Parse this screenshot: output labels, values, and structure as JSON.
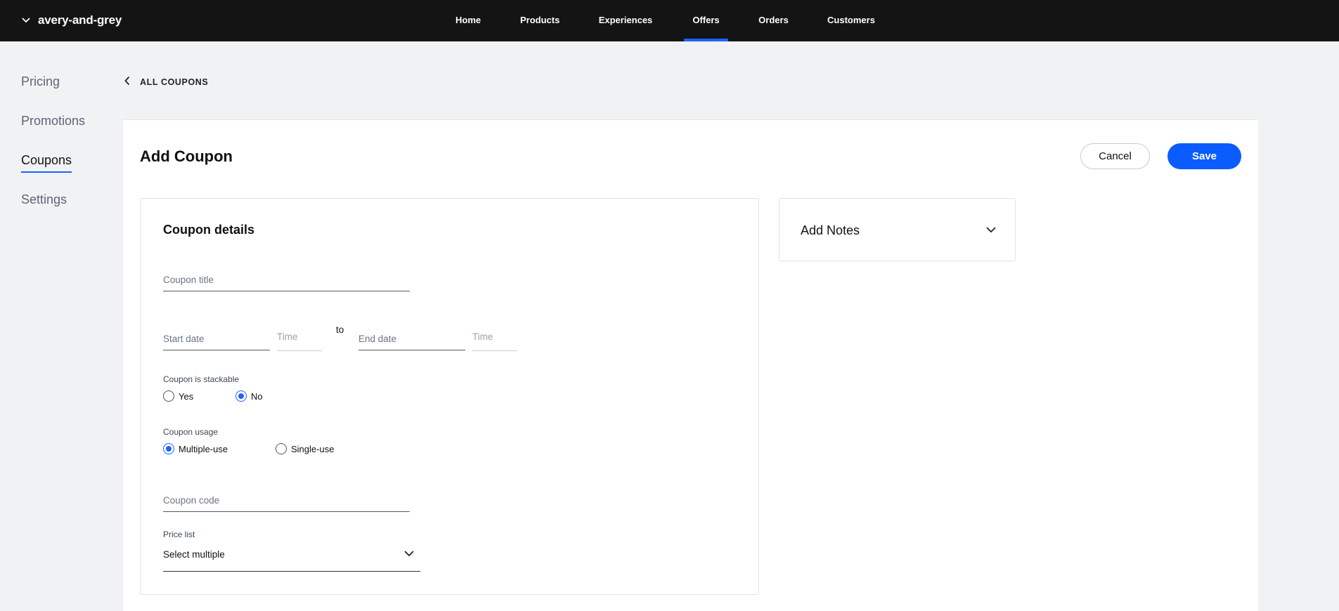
{
  "topbar": {
    "store_name": "avery-and-grey",
    "nav": [
      "Home",
      "Products",
      "Experiences",
      "Offers",
      "Orders",
      "Customers"
    ],
    "active_nav": "Offers"
  },
  "sidebar": {
    "items": [
      "Pricing",
      "Promotions",
      "Coupons",
      "Settings"
    ],
    "active": "Coupons"
  },
  "breadcrumb": {
    "back_label": "ALL COUPONS"
  },
  "page": {
    "title": "Add Coupon",
    "cancel_label": "Cancel",
    "save_label": "Save"
  },
  "details": {
    "title": "Coupon details",
    "coupon_title_placeholder": "Coupon title",
    "start_date_placeholder": "Start date",
    "start_time_placeholder": "Time",
    "to_label": "to",
    "end_date_placeholder": "End date",
    "end_time_placeholder": "Time",
    "stackable_label": "Coupon is stackable",
    "stackable_yes": "Yes",
    "stackable_no": "No",
    "stackable_selected": "No",
    "usage_label": "Coupon usage",
    "usage_multiple": "Multiple-use",
    "usage_single": "Single-use",
    "usage_selected": "Multiple-use",
    "coupon_code_placeholder": "Coupon code",
    "price_list_label": "Price list",
    "price_list_value": "Select multiple"
  },
  "notes": {
    "title": "Add Notes"
  },
  "colors": {
    "accent": "#0b5cff",
    "topbar": "#141414",
    "background": "#f1f2f4"
  }
}
